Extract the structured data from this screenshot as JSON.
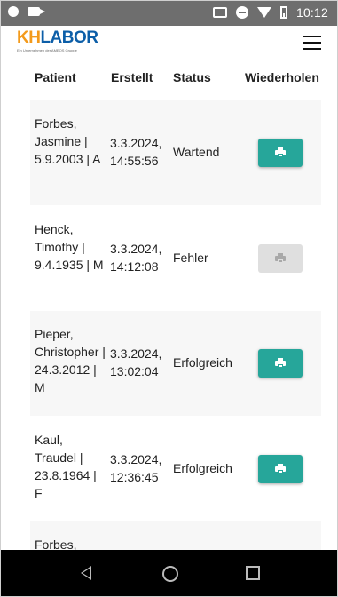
{
  "status_bar": {
    "time": "10:12"
  },
  "app": {
    "logo_kh": "KH",
    "logo_labor": "LABOR",
    "logo_sub": "Ein Unternehmen der AMEOS Gruppe"
  },
  "table": {
    "headers": {
      "patient": "Patient",
      "created": "Erstellt",
      "status": "Status",
      "repeat": "Wiederholen"
    },
    "rows": [
      {
        "patient": "Forbes, Jasmine | 5.9.2003 | A",
        "created": "3.3.2024, 14:55:56",
        "status": "Wartend",
        "print_enabled": true
      },
      {
        "patient": "Henck, Timothy | 9.4.1935 | M",
        "created": "3.3.2024, 14:12:08",
        "status": "Fehler",
        "print_enabled": false
      },
      {
        "patient": "Pieper, Christopher | 24.3.2012 | M",
        "created": "3.3.2024, 13:02:04",
        "status": "Erfolgreich",
        "print_enabled": true
      },
      {
        "patient": "Kaul, Traudel | 23.8.1964 | F",
        "created": "3.3.2024, 12:36:45",
        "status": "Erfolgreich",
        "print_enabled": true
      },
      {
        "patient": "Forbes,",
        "created": "",
        "status": "",
        "print_enabled": true
      }
    ]
  },
  "colors": {
    "accent": "#26a69a",
    "disabled": "#dfdfdf",
    "logo_orange": "#f39a1b",
    "logo_blue": "#0c5ea8"
  },
  "icons": {
    "print": "printer-icon",
    "menu": "hamburger-menu-icon"
  }
}
